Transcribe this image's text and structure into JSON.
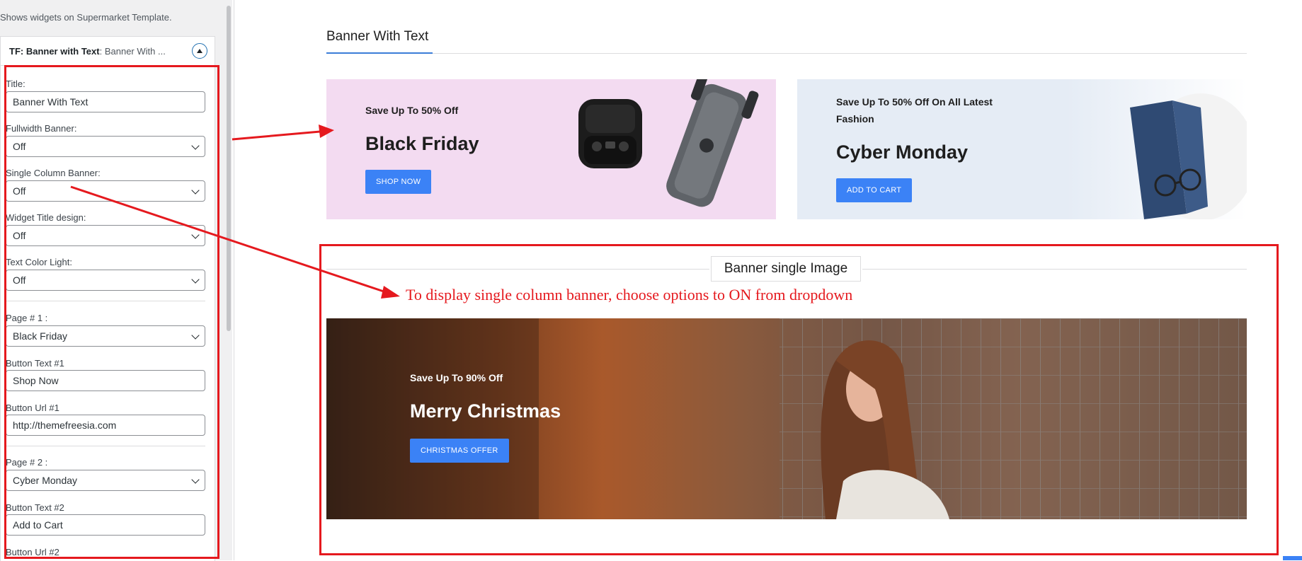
{
  "sidebar": {
    "description": "Shows widgets on Supermarket Template.",
    "widget": {
      "title_bold": "TF: Banner with Text",
      "title_sub": ": Banner With ..."
    },
    "fields": {
      "title_label": "Title:",
      "title_value": "Banner With Text",
      "fullwidth_label": "Fullwidth Banner:",
      "fullwidth_value": "Off",
      "single_column_label": "Single Column Banner:",
      "single_column_value": "Off",
      "widget_title_design_label": "Widget Title design:",
      "widget_title_design_value": "Off",
      "text_color_light_label": "Text Color Light:",
      "text_color_light_value": "Off",
      "page1_label": "Page # 1 :",
      "page1_value": "Black Friday",
      "button_text1_label": "Button Text #1",
      "button_text1_value": "Shop Now",
      "button_url1_label": "Button Url #1",
      "button_url1_value": "http://themefreesia.com",
      "page2_label": "Page # 2 :",
      "page2_value": "Cyber Monday",
      "button_text2_label": "Button Text #2",
      "button_text2_value": "Add to Cart",
      "button_url2_label": "Button Url #2"
    }
  },
  "main": {
    "section_title": "Banner With Text",
    "banners": [
      {
        "subtitle": "Save Up To 50% Off",
        "title": "Black Friday",
        "button": "SHOP NOW"
      },
      {
        "subtitle": "Save Up To 50% Off On All Latest Fashion",
        "title": "Cyber Monday",
        "button": "ADD TO CART"
      }
    ],
    "single_section_title": "Banner single Image",
    "annotation": "To display single column banner, choose options to ON from dropdown",
    "single_banner": {
      "subtitle": "Save Up To 90% Off",
      "title": "Merry Christmas",
      "button": "CHRISTMAS OFFER"
    }
  },
  "colors": {
    "accent": "#3b82f6",
    "annotation_red": "#e5191e",
    "banner1_bg": "#f3dbf1",
    "banner2_bg": "#e5ecf5"
  }
}
